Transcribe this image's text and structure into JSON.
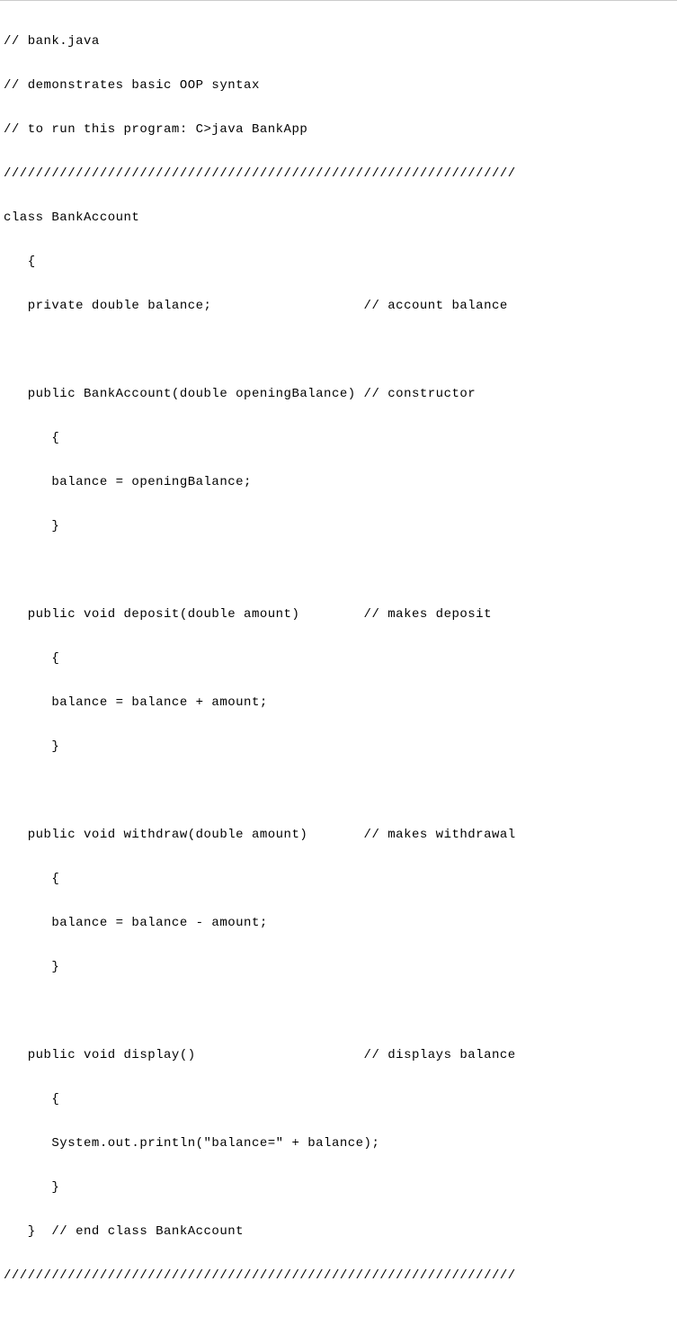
{
  "code": {
    "lines": [
      "// bank.java",
      "// demonstrates basic OOP syntax",
      "// to run this program: C>java BankApp",
      "////////////////////////////////////////////////////////////////",
      "class BankAccount",
      "   {",
      "   private double balance;                   // account balance",
      "",
      "   public BankAccount(double openingBalance) // constructor",
      "      {",
      "      balance = openingBalance;",
      "      }",
      "",
      "   public void deposit(double amount)        // makes deposit",
      "      {",
      "      balance = balance + amount;",
      "      }",
      "",
      "   public void withdraw(double amount)       // makes withdrawal",
      "      {",
      "      balance = balance - amount;",
      "      }",
      "",
      "   public void display()                     // displays balance",
      "      {",
      "      System.out.println(\"balance=\" + balance);",
      "      }",
      "   }  // end class BankAccount",
      "////////////////////////////////////////////////////////////////"
    ]
  }
}
